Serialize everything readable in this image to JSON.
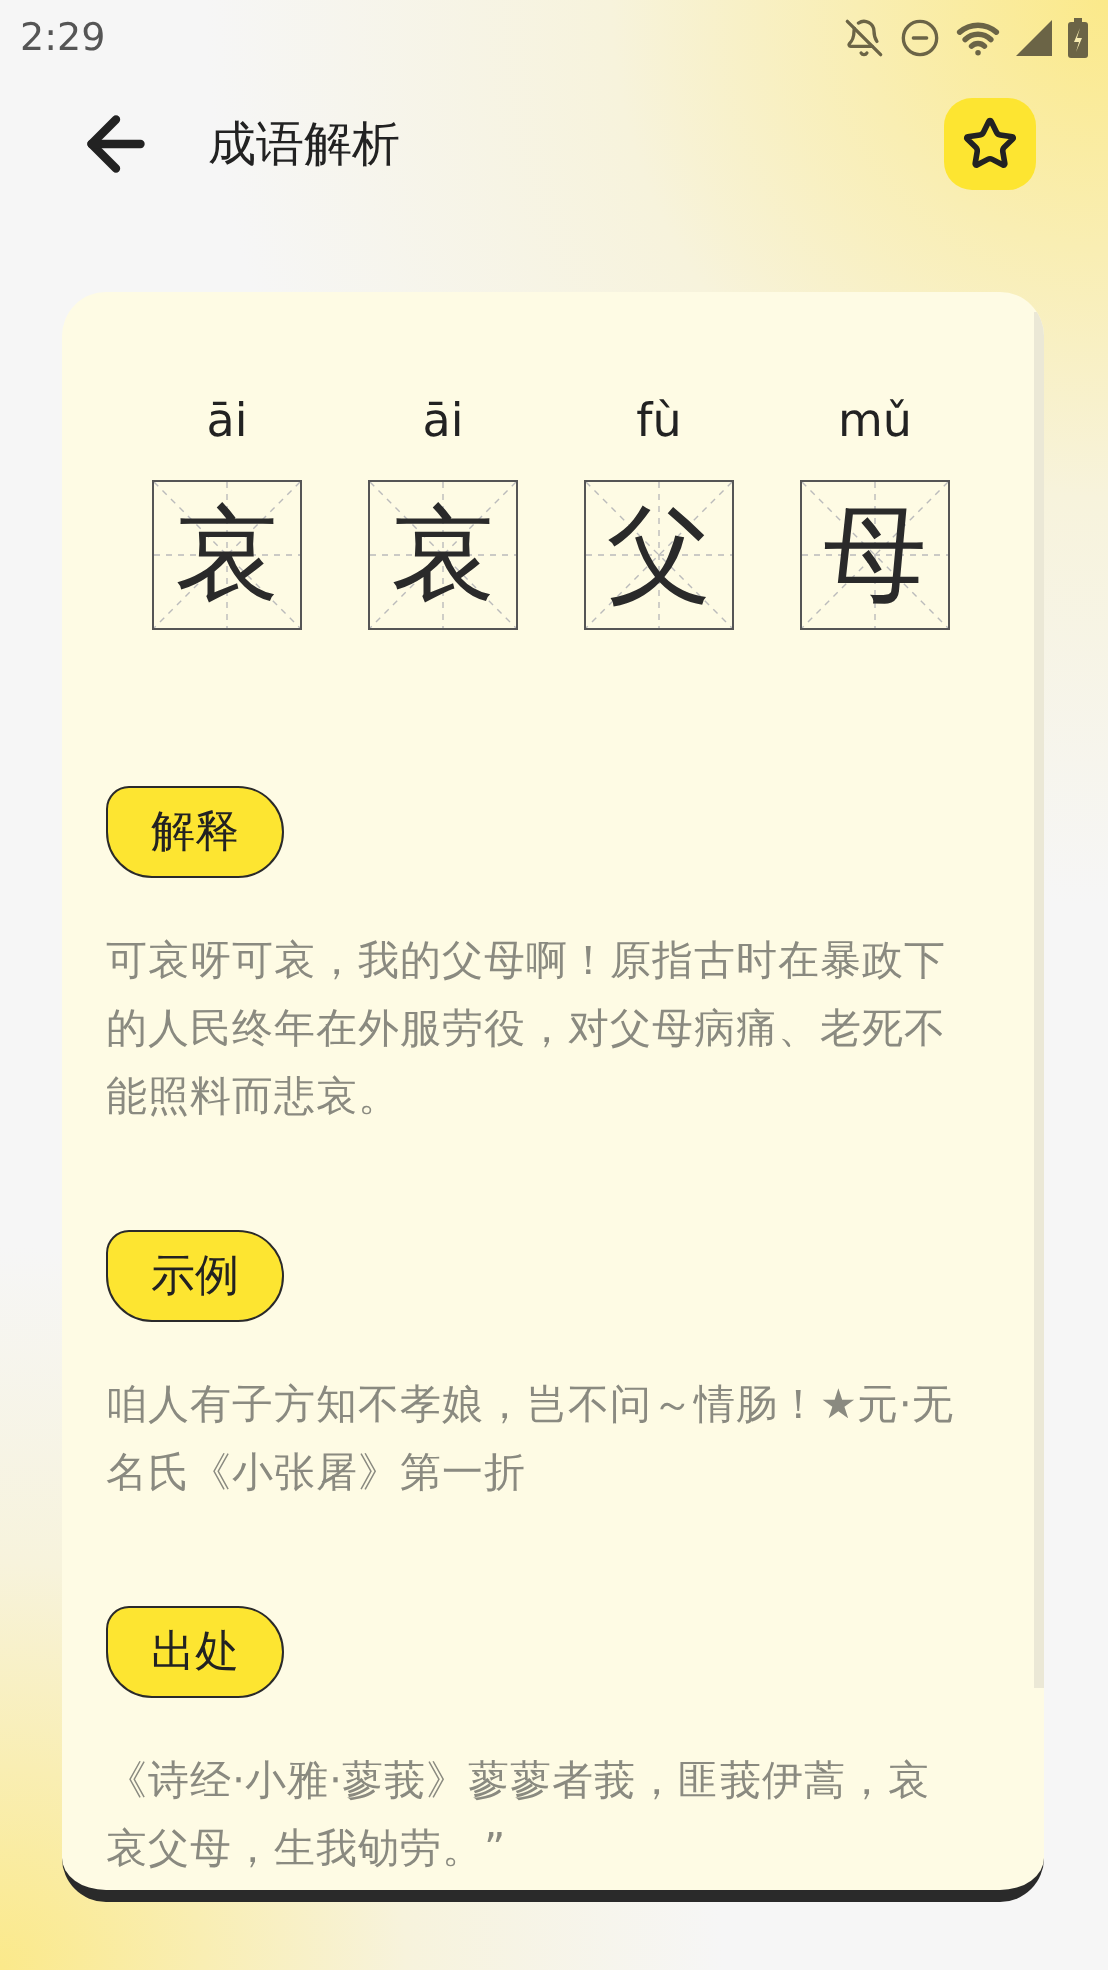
{
  "status_bar": {
    "time": "2:29"
  },
  "header": {
    "title": "成语解析",
    "favorite": false
  },
  "idiom": [
    {
      "pinyin": "āi",
      "char": "哀"
    },
    {
      "pinyin": "āi",
      "char": "哀"
    },
    {
      "pinyin": "fù",
      "char": "父"
    },
    {
      "pinyin": "mǔ",
      "char": "母"
    }
  ],
  "sections": [
    {
      "label": "解释",
      "text": "可哀呀可哀，我的父母啊！原指古时在暴政下的人民终年在外服劳役，对父母病痛、老死不能照料而悲哀。"
    },
    {
      "label": "示例",
      "text": "咱人有子方知不孝娘，岂不问～情肠！★元·无名氏《小张屠》第一折"
    },
    {
      "label": "出处",
      "text": "《诗经·小雅·蓼莪》蓼蓼者莪，匪莪伊蒿，哀哀父母，生我劬劳。”"
    }
  ]
}
